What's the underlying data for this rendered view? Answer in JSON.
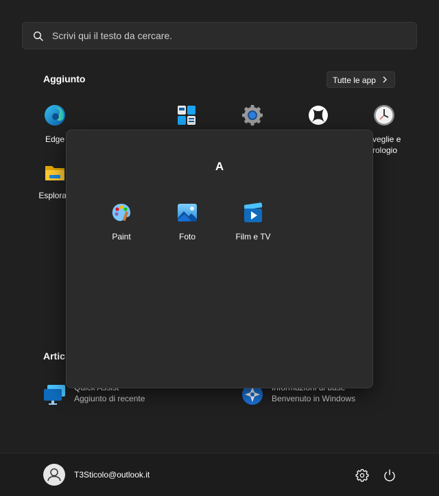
{
  "search": {
    "placeholder": "Scrivi qui il testo da cercare."
  },
  "pinned": {
    "title": "Aggiunto",
    "all_apps_label": "Tutte le app",
    "apps": [
      {
        "label": "Edge",
        "icon": "edge-icon"
      },
      {
        "label": "",
        "icon": "microsoft-store-icon"
      },
      {
        "label": "",
        "icon": "settings-icon"
      },
      {
        "label": "",
        "icon": "xbox-icon"
      },
      {
        "label": "Sveglie e orologio",
        "label_visible": "veglie e\nrologio",
        "icon": "clock-icon"
      },
      {
        "label": "Esplora f",
        "icon": "file-explorer-icon"
      }
    ]
  },
  "folder": {
    "title": "A",
    "apps": [
      {
        "label": "Paint",
        "icon": "paint-icon"
      },
      {
        "label": "Foto",
        "icon": "photos-icon"
      },
      {
        "label": "Film e TV",
        "icon": "film-tv-icon"
      }
    ]
  },
  "recommended": {
    "title": "Artic",
    "items": [
      {
        "title": "Quick Assist",
        "subtitle": "Aggiunto di recente",
        "icon": "quick-assist-icon"
      },
      {
        "title": "Informazioni di base",
        "subtitle": "Benvenuto in Windows",
        "icon": "get-started-icon"
      }
    ]
  },
  "user": {
    "email": "T3Sticolo@outlook.it"
  },
  "colors": {
    "background": "#202020",
    "panel": "#2b2b2b",
    "accent": "#0078d4"
  }
}
